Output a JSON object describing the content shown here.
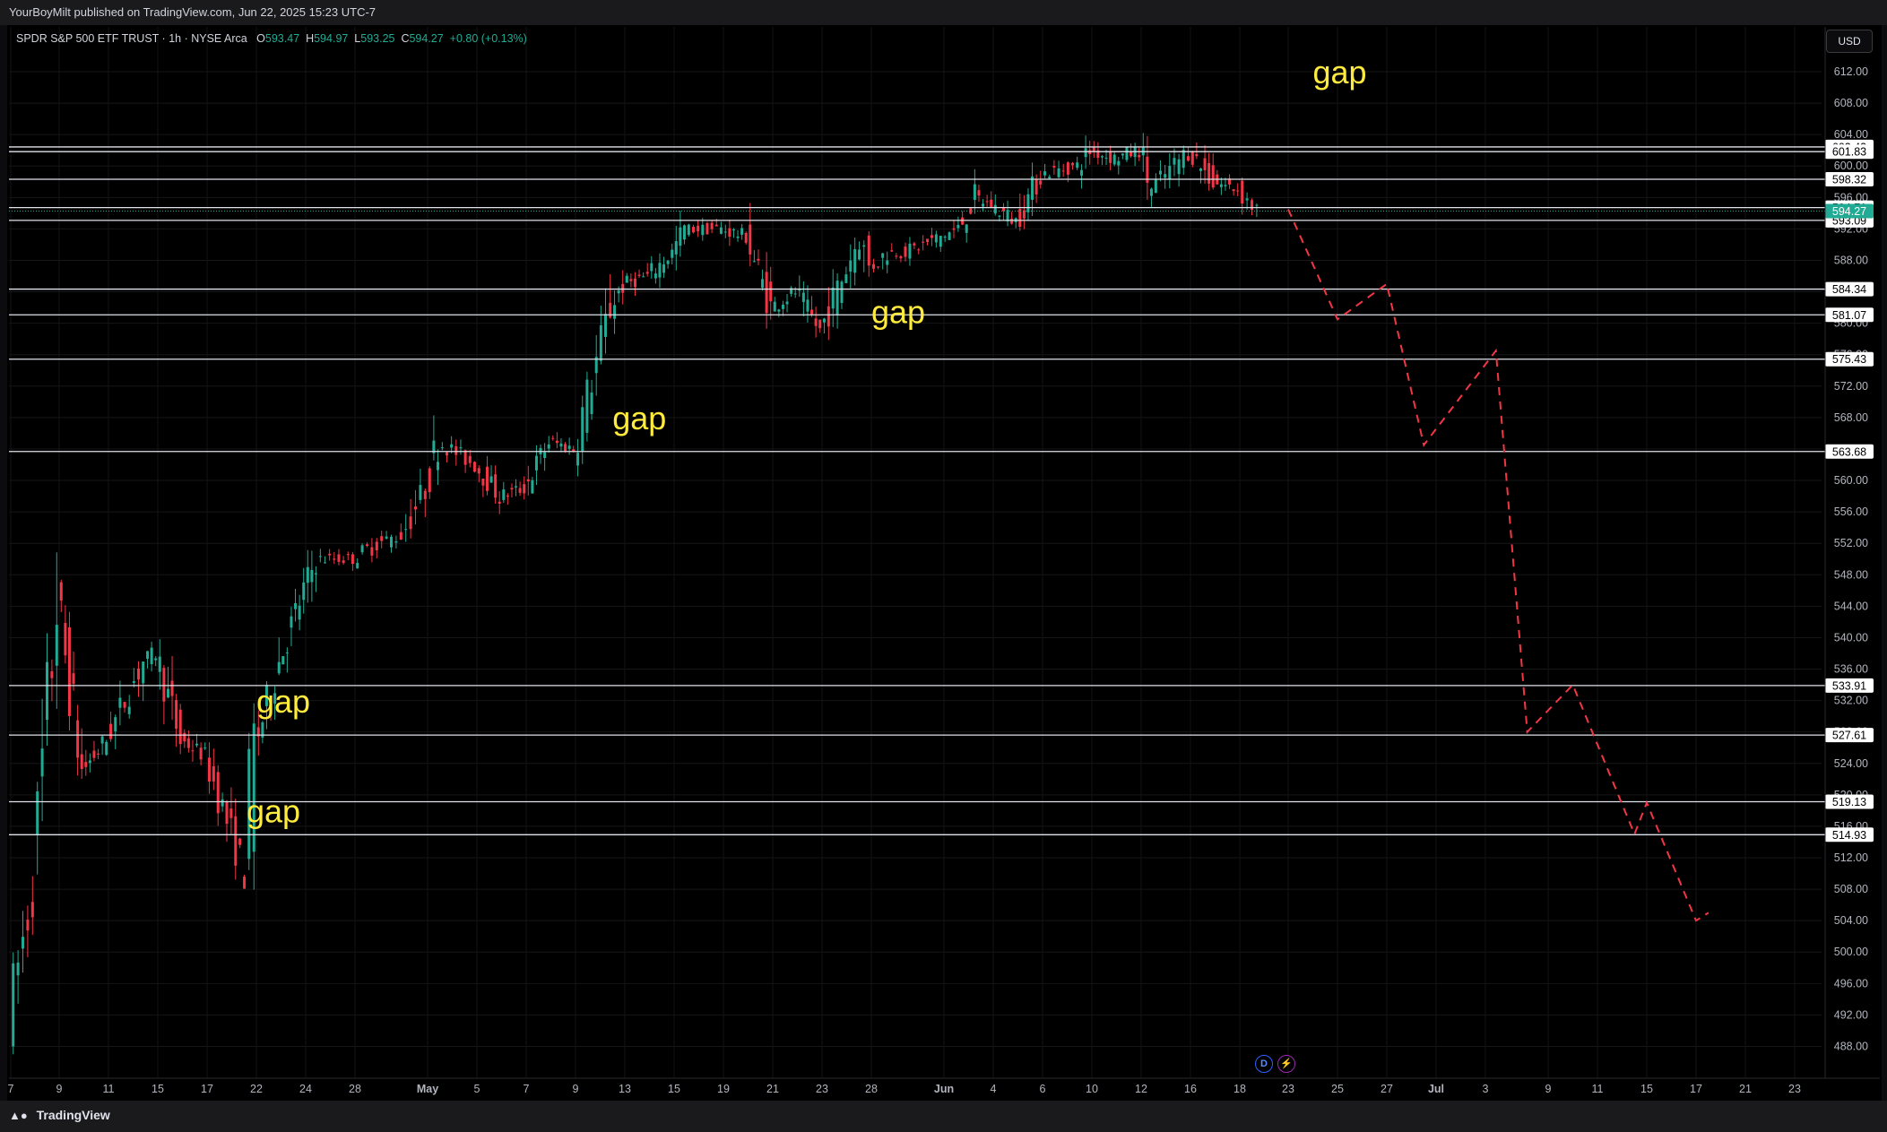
{
  "header": {
    "published": "YourBoyMilt published on TradingView.com, Jun 22, 2025 15:23 UTC-7"
  },
  "legend": {
    "symbol": "SPDR S&P 500 ETF TRUST · 1h · NYSE Arca",
    "open_label": "O",
    "open": "593.47",
    "high_label": "H",
    "high": "594.97",
    "low_label": "L",
    "low": "593.25",
    "close_label": "C",
    "close": "594.27",
    "change": "+0.80 (+0.13%)"
  },
  "currency": "USD",
  "footer": {
    "brand": "TradingView",
    "logo": "tradingview-logo-icon"
  },
  "event_icons": [
    {
      "label": "D",
      "name": "dividend-icon",
      "color": "#2962ff"
    },
    {
      "label": "⚡",
      "name": "earnings-icon",
      "color": "#9c27b0"
    }
  ],
  "colors": {
    "up": "#22ab94",
    "down": "#f23645",
    "annotation": "#ffeb3b",
    "projection": "#f23645",
    "level": "#e0e3eb",
    "last_price_bg": "#22ab94"
  },
  "chart_data": {
    "type": "candlestick",
    "ylim": [
      485,
      614.5
    ],
    "y_ticks": [
      "612.00",
      "608.00",
      "604.00",
      "600.00",
      "596.00",
      "592.00",
      "588.00",
      "584.00",
      "580.00",
      "576.00",
      "572.00",
      "568.00",
      "564.00",
      "560.00",
      "556.00",
      "552.00",
      "548.00",
      "544.00",
      "540.00",
      "536.00",
      "532.00",
      "528.00",
      "524.00",
      "520.00",
      "516.00",
      "512.00",
      "508.00",
      "504.00",
      "500.00",
      "496.00",
      "492.00",
      "488.00"
    ],
    "x_ticks": [
      "7",
      "9",
      "11",
      "15",
      "17",
      "22",
      "24",
      "28",
      "May",
      "5",
      "7",
      "9",
      "13",
      "15",
      "19",
      "21",
      "23",
      "28",
      "Jun",
      "4",
      "6",
      "10",
      "12",
      "16",
      "18",
      "23",
      "25",
      "27",
      "Jul",
      "3",
      "9",
      "11",
      "15",
      "17",
      "21",
      "23"
    ],
    "x_bold": [
      "May",
      "Jun",
      "Jul"
    ],
    "last_price": "594.27",
    "horizontal_levels": [
      "602.43",
      "601.83",
      "598.32",
      "594.71",
      "593.09",
      "584.34",
      "581.07",
      "575.43",
      "563.68",
      "533.91",
      "527.61",
      "519.13",
      "514.93"
    ],
    "annotations": [
      {
        "text": "gap",
        "x": "Apr 22",
        "y": 530.5
      },
      {
        "text": "gap",
        "x": "Apr 21",
        "y": 516.5
      },
      {
        "text": "gap",
        "x": "May 12",
        "y": 566.5
      },
      {
        "text": "gap",
        "x": "May 28",
        "y": 580.0
      },
      {
        "text": "gap",
        "x": "Jun 24",
        "y": 610.5
      }
    ],
    "price_path": [
      [
        "Apr 7",
        492
      ],
      [
        "Apr 8",
        508
      ],
      [
        "Apr 9",
        545
      ],
      [
        "Apr 10",
        523
      ],
      [
        "Apr 11",
        527
      ],
      [
        "Apr 14",
        537
      ],
      [
        "Apr 15",
        538
      ],
      [
        "Apr 16",
        527
      ],
      [
        "Apr 17",
        525
      ],
      [
        "Apr 21",
        510
      ],
      [
        "Apr 22",
        526
      ],
      [
        "Apr 23",
        537
      ],
      [
        "Apr 24",
        546
      ],
      [
        "Apr 25",
        550
      ],
      [
        "Apr 28",
        550
      ],
      [
        "Apr 29",
        552
      ],
      [
        "Apr 30",
        553
      ],
      [
        "May 1",
        559
      ],
      [
        "May 2",
        565
      ],
      [
        "May 5",
        562
      ],
      [
        "May 6",
        558
      ],
      [
        "May 7",
        559
      ],
      [
        "May 8",
        565
      ],
      [
        "May 9",
        564
      ],
      [
        "May 12",
        582
      ],
      [
        "May 13",
        585
      ],
      [
        "May 14",
        586
      ],
      [
        "May 15",
        589
      ],
      [
        "May 16",
        592
      ],
      [
        "May 19",
        592
      ],
      [
        "May 20",
        591
      ],
      [
        "May 21",
        582
      ],
      [
        "May 22",
        584
      ],
      [
        "May 23",
        579
      ],
      [
        "May 27",
        591
      ],
      [
        "May 28",
        587
      ],
      [
        "May 29",
        589
      ],
      [
        "May 30",
        589
      ],
      [
        "Jun 2",
        592
      ],
      [
        "Jun 3",
        596
      ],
      [
        "Jun 4",
        595
      ],
      [
        "Jun 5",
        593
      ],
      [
        "Jun 6",
        599
      ],
      [
        "Jun 9",
        600
      ],
      [
        "Jun 10",
        602
      ],
      [
        "Jun 11",
        601
      ],
      [
        "Jun 12",
        602
      ],
      [
        "Jun 13",
        597
      ],
      [
        "Jun 16",
        602
      ],
      [
        "Jun 17",
        598
      ],
      [
        "Jun 18",
        597
      ],
      [
        "Jun 20",
        594.3
      ]
    ],
    "projection_path": [
      [
        "Jun 23",
        594.5
      ],
      [
        "Jun 25",
        580.5
      ],
      [
        "Jun 27",
        585
      ],
      [
        "Jun 30",
        564.5
      ],
      [
        "Jul 4",
        576.5
      ],
      [
        "Jul 7",
        528
      ],
      [
        "Jul 10",
        534
      ],
      [
        "Jul 14",
        515
      ],
      [
        "Jul 15",
        519
      ],
      [
        "Jul 17",
        504
      ],
      [
        "Jul 18",
        505
      ]
    ]
  }
}
